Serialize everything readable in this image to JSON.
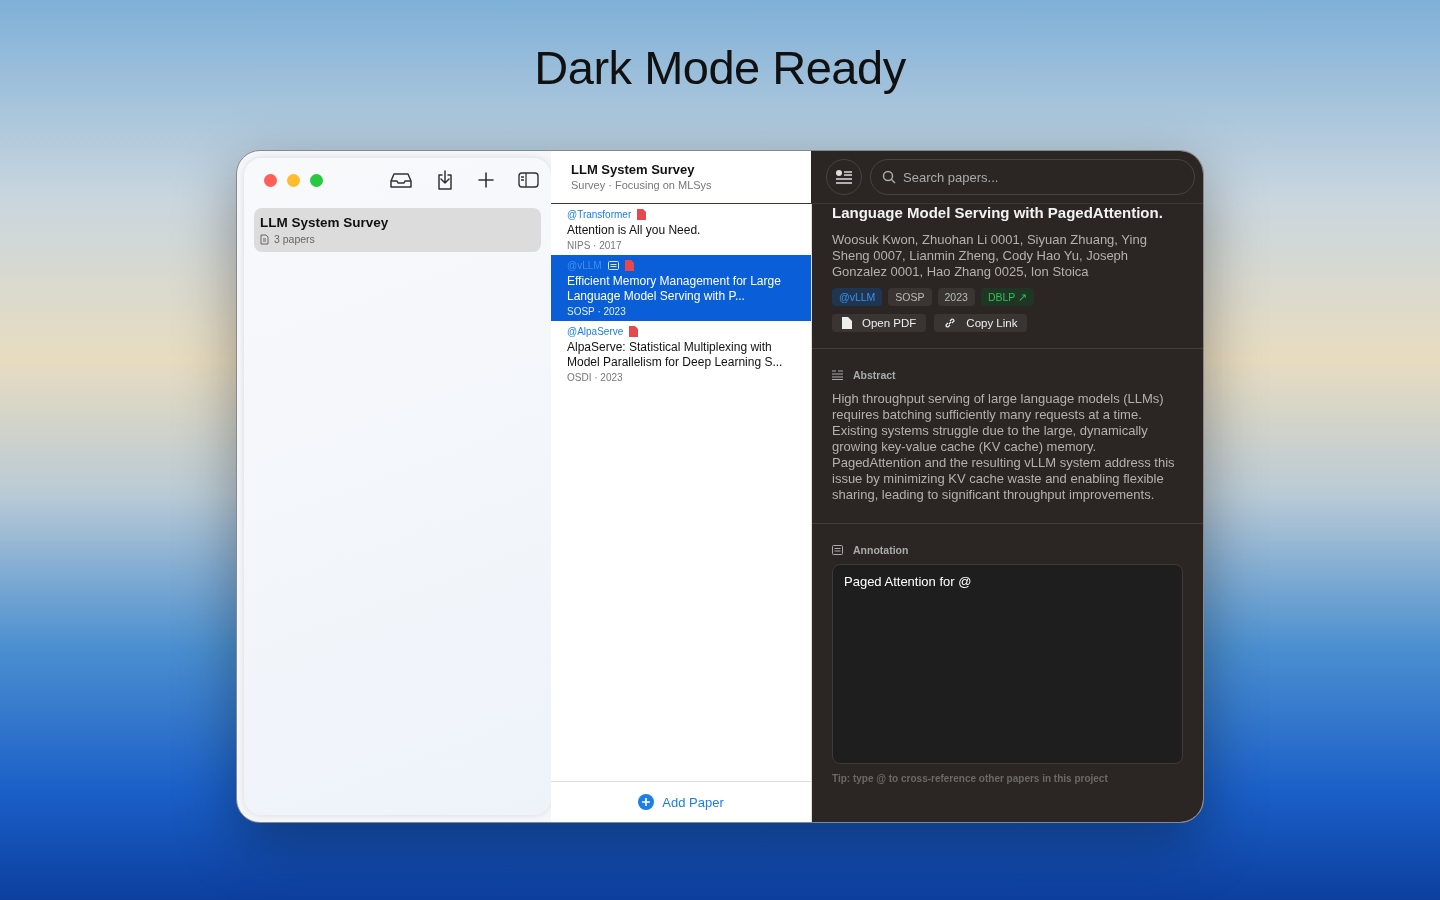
{
  "headline": "Dark Mode Ready",
  "sidebar": {
    "projects": [
      {
        "name": "LLM System Survey",
        "count": "3 papers",
        "selected": true
      }
    ]
  },
  "header": {
    "title": "LLM System Survey",
    "subtitle": "Survey · Focusing on MLSys"
  },
  "search": {
    "placeholder": "Search papers..."
  },
  "papers": [
    {
      "key": "@Transformer",
      "has_note": false,
      "has_pdf": true,
      "title": "Attention is All you Need.",
      "venue": "NIPS · 2017",
      "selected": false
    },
    {
      "key": "@vLLM",
      "has_note": true,
      "has_pdf": true,
      "title": "Efficient Memory Management for Large Language Model Serving with P...",
      "venue": "SOSP · 2023",
      "selected": true
    },
    {
      "key": "@AlpaServe",
      "has_note": false,
      "has_pdf": true,
      "title": "AlpaServe: Statistical Multiplexing with Model Parallelism for Deep Learning S...",
      "venue": "OSDI · 2023",
      "selected": false
    }
  ],
  "add_button": "Add Paper",
  "detail": {
    "title": "Language Model Serving with PagedAttention.",
    "authors": "Woosuk Kwon, Zhuohan Li 0001, Siyuan Zhuang, Ying Sheng 0007, Lianmin Zheng, Cody Hao Yu, Joseph Gonzalez 0001, Hao Zhang 0025, Ion Stoica",
    "tags": [
      {
        "label": "@vLLM",
        "kind": "key"
      },
      {
        "label": "SOSP",
        "kind": "plain"
      },
      {
        "label": "2023",
        "kind": "plain"
      },
      {
        "label": "DBLP ↗",
        "kind": "link"
      }
    ],
    "actions": [
      {
        "label": "Open PDF",
        "kind": "pdf"
      },
      {
        "label": "Copy Link",
        "kind": "link"
      }
    ],
    "abstract_label": "Abstract",
    "abstract": "High throughput serving of large language models (LLMs) requires batching sufficiently many requests at a time. Existing systems struggle due to the large, dynamically growing key-value cache (KV cache) memory. PagedAttention and the resulting vLLM system address this issue by minimizing KV cache waste and enabling flexible sharing, leading to significant throughput improvements.",
    "annotation_label": "Annotation",
    "annotation": "Paged Attention for @",
    "tip": "Tip: type @ to cross-reference other papers in this project"
  }
}
